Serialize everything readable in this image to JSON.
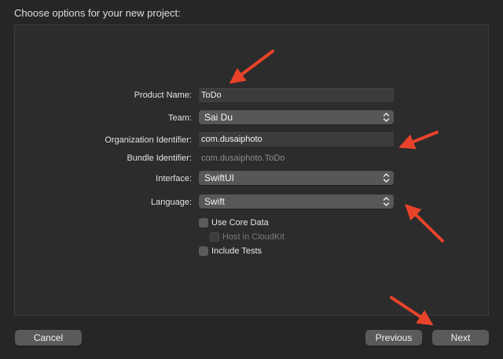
{
  "sheet": {
    "title": "Choose options for your new project:"
  },
  "form": {
    "product_name": {
      "label": "Product Name:",
      "value": "ToDo"
    },
    "team": {
      "label": "Team:",
      "value": "Sai Du"
    },
    "organization_identifier": {
      "label": "Organization Identifier:",
      "value": "com.dusaiphoto"
    },
    "bundle_identifier": {
      "label": "Bundle Identifier:",
      "value": "com.dusaiphoto.ToDo"
    },
    "interface": {
      "label": "Interface:",
      "value": "SwiftUI"
    },
    "language": {
      "label": "Language:",
      "value": "Swift"
    },
    "use_core_data": {
      "label": "Use Core Data",
      "checked": false
    },
    "host_in_cloudkit": {
      "label": "Host in CloudKit",
      "checked": false,
      "enabled": false
    },
    "include_tests": {
      "label": "Include Tests",
      "checked": false
    }
  },
  "buttons": {
    "cancel": "Cancel",
    "previous": "Previous",
    "next": "Next"
  },
  "colors": {
    "background": "#262626",
    "panel": "#2c2c2c",
    "annotation_arrow": "#e8432a"
  },
  "icons": {
    "popup_indicator": "chevron-up-down-icon",
    "annotation": "red-arrow-icon"
  }
}
